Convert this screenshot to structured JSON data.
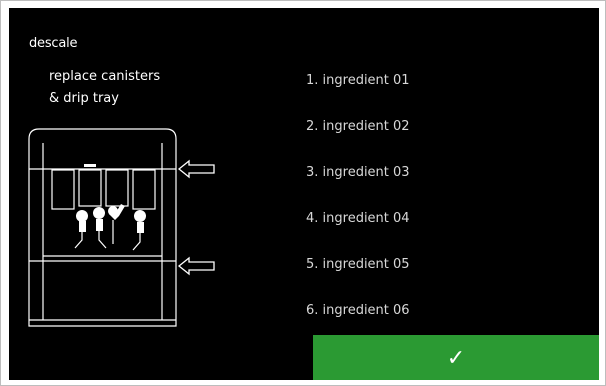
{
  "screen": {
    "title": "descale",
    "instruction_line1": "replace canisters",
    "instruction_line2": "& drip tray"
  },
  "ingredients": [
    "1. ingredient 01",
    "2. ingredient 02",
    "3. ingredient 03",
    "4. ingredient 04",
    "5. ingredient 05",
    "6. ingredient 06"
  ],
  "confirm_button": {
    "label": "✓",
    "icon": "checkmark-icon",
    "color": "#2b9a33"
  },
  "illustration": {
    "subject": "machine-front-canisters-drip-tray",
    "arrow_icons": [
      "arrow-left-icon",
      "arrow-left-icon"
    ]
  },
  "colors": {
    "panel_background": "#000000",
    "text": "#ffffff",
    "accent": "#2b9a33"
  }
}
